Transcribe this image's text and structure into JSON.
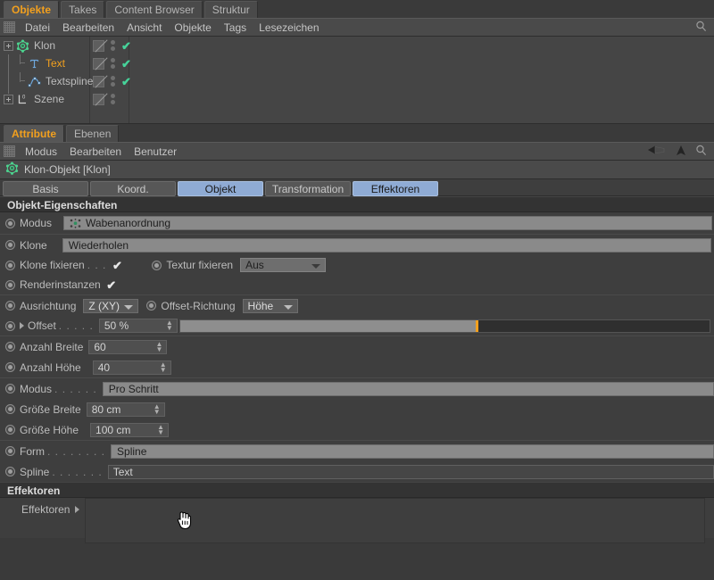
{
  "object_panel": {
    "tabs": [
      {
        "label": "Objekte",
        "active": true
      },
      {
        "label": "Takes",
        "active": false
      },
      {
        "label": "Content Browser",
        "active": false
      },
      {
        "label": "Struktur",
        "active": false
      }
    ],
    "menu": [
      "Datei",
      "Bearbeiten",
      "Ansicht",
      "Objekte",
      "Tags",
      "Lesezeichen"
    ],
    "search_icon": "search-icon",
    "tree": [
      {
        "name": "Klon",
        "icon": "cloner-icon",
        "selected": false,
        "depth": 0,
        "expandable": true,
        "has_check": true
      },
      {
        "name": "Text",
        "icon": "text-spline-icon",
        "selected": true,
        "depth": 1,
        "expandable": false,
        "has_check": true
      },
      {
        "name": "Textspline",
        "icon": "spline-icon",
        "selected": false,
        "depth": 1,
        "expandable": false,
        "has_check": true
      },
      {
        "name": "Szene",
        "icon": "scene-axis-icon",
        "selected": false,
        "depth": 0,
        "expandable": true,
        "has_check": false
      }
    ]
  },
  "attribute_panel": {
    "tabs": [
      {
        "label": "Attribute",
        "active": true
      },
      {
        "label": "Ebenen",
        "active": false
      }
    ],
    "menu": [
      "Modus",
      "Bearbeiten",
      "Benutzer"
    ],
    "toolbar_icons": [
      "back-arrow-icon",
      "up-arrow-icon",
      "search-icon"
    ],
    "object_title": "Klon-Objekt [Klon]",
    "object_title_icon": "cloner-icon",
    "mode_tabs": [
      {
        "label": "Basis",
        "active": false
      },
      {
        "label": "Koord.",
        "active": false
      },
      {
        "label": "Objekt",
        "active": true
      },
      {
        "label": "Transformation",
        "active": false
      },
      {
        "label": "Effektoren",
        "active": true
      }
    ]
  },
  "object_properties": {
    "section_title": "Objekt-Eigenschaften",
    "modus": {
      "label": "Modus",
      "value": "Wabenanordnung",
      "icon": "honeycomb-icon"
    },
    "klone": {
      "label": "Klone",
      "value": "Wiederholen"
    },
    "klone_fixieren": {
      "label": "Klone fixieren",
      "dots": ". . .",
      "checked": true
    },
    "textur_fixieren": {
      "label": "Textur fixieren",
      "value": "Aus"
    },
    "renderinstanzen": {
      "label": "Renderinstanzen",
      "checked": true
    },
    "ausrichtung": {
      "label": "Ausrichtung",
      "value": "Z (XY)"
    },
    "offset_richtung": {
      "label": "Offset-Richtung",
      "value": "Höhe"
    },
    "offset": {
      "label": "Offset",
      "dots": ". . . . .",
      "value": "50 %",
      "slider_percent": 56
    },
    "anzahl_breite": {
      "label": "Anzahl Breite",
      "value": "60"
    },
    "anzahl_hoehe": {
      "label": "Anzahl Höhe",
      "value": "40"
    },
    "modus2": {
      "label": "Modus",
      "dots": ". . . . . .",
      "value": "Pro Schritt"
    },
    "groesse_breite": {
      "label": "Größe Breite",
      "value": "80 cm"
    },
    "groesse_hoehe": {
      "label": "Größe Höhe",
      "value": "100 cm"
    },
    "form": {
      "label": "Form",
      "dots": ". . . . . . . .",
      "value": "Spline"
    },
    "spline": {
      "label": "Spline",
      "dots": ". . . . . . .",
      "value": "Text"
    }
  },
  "effectors": {
    "section_title": "Effektoren",
    "field_label": "Effektoren",
    "items": []
  },
  "colors": {
    "accent_orange": "#f2a01e",
    "tab_active_blue": "#8fabd4",
    "check_green": "#46d39a",
    "panel_bg": "#3e3e3e"
  }
}
